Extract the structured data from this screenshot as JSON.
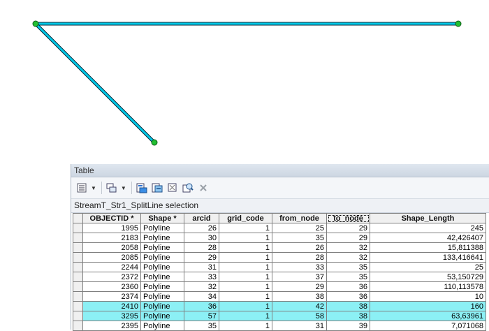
{
  "table": {
    "title": "Table",
    "layer_name": "StreamT_Str1_SplitLine selection",
    "columns": [
      "OBJECTID *",
      "Shape *",
      "arcid",
      "grid_code",
      "from_node",
      "to_node",
      "Shape_Length"
    ],
    "sorted_column": "to_node",
    "rows": [
      {
        "OBJECTID": "1995",
        "Shape": "Polyline",
        "arcid": "26",
        "grid_code": "1",
        "from_node": "25",
        "to_node": "29",
        "Shape_Length": "245",
        "highlighted": false
      },
      {
        "OBJECTID": "2183",
        "Shape": "Polyline",
        "arcid": "30",
        "grid_code": "1",
        "from_node": "35",
        "to_node": "29",
        "Shape_Length": "42,426407",
        "highlighted": false
      },
      {
        "OBJECTID": "2058",
        "Shape": "Polyline",
        "arcid": "28",
        "grid_code": "1",
        "from_node": "26",
        "to_node": "32",
        "Shape_Length": "15,811388",
        "highlighted": false
      },
      {
        "OBJECTID": "2085",
        "Shape": "Polyline",
        "arcid": "29",
        "grid_code": "1",
        "from_node": "28",
        "to_node": "32",
        "Shape_Length": "133,416641",
        "highlighted": false
      },
      {
        "OBJECTID": "2244",
        "Shape": "Polyline",
        "arcid": "31",
        "grid_code": "1",
        "from_node": "33",
        "to_node": "35",
        "Shape_Length": "25",
        "highlighted": false
      },
      {
        "OBJECTID": "2372",
        "Shape": "Polyline",
        "arcid": "33",
        "grid_code": "1",
        "from_node": "37",
        "to_node": "35",
        "Shape_Length": "53,150729",
        "highlighted": false
      },
      {
        "OBJECTID": "2360",
        "Shape": "Polyline",
        "arcid": "32",
        "grid_code": "1",
        "from_node": "29",
        "to_node": "36",
        "Shape_Length": "110,113578",
        "highlighted": false
      },
      {
        "OBJECTID": "2374",
        "Shape": "Polyline",
        "arcid": "34",
        "grid_code": "1",
        "from_node": "38",
        "to_node": "36",
        "Shape_Length": "10",
        "highlighted": false
      },
      {
        "OBJECTID": "2410",
        "Shape": "Polyline",
        "arcid": "36",
        "grid_code": "1",
        "from_node": "42",
        "to_node": "38",
        "Shape_Length": "160",
        "highlighted": true
      },
      {
        "OBJECTID": "3295",
        "Shape": "Polyline",
        "arcid": "57",
        "grid_code": "1",
        "from_node": "58",
        "to_node": "38",
        "Shape_Length": "63,63961",
        "highlighted": true
      },
      {
        "OBJECTID": "2395",
        "Shape": "Polyline",
        "arcid": "35",
        "grid_code": "1",
        "from_node": "31",
        "to_node": "39",
        "Shape_Length": "7,071068",
        "highlighted": false
      }
    ]
  },
  "colors": {
    "selection_highlight": "#8cf0f5",
    "map_line": "#00c8e6",
    "map_vertex": "#22c032"
  },
  "toolbar": {
    "icons": [
      "table-options-icon",
      "related-tables-icon",
      "select-by-attributes-icon",
      "switch-selection-icon",
      "clear-selection-icon",
      "zoom-to-selected-icon",
      "delete-selected-icon"
    ]
  }
}
